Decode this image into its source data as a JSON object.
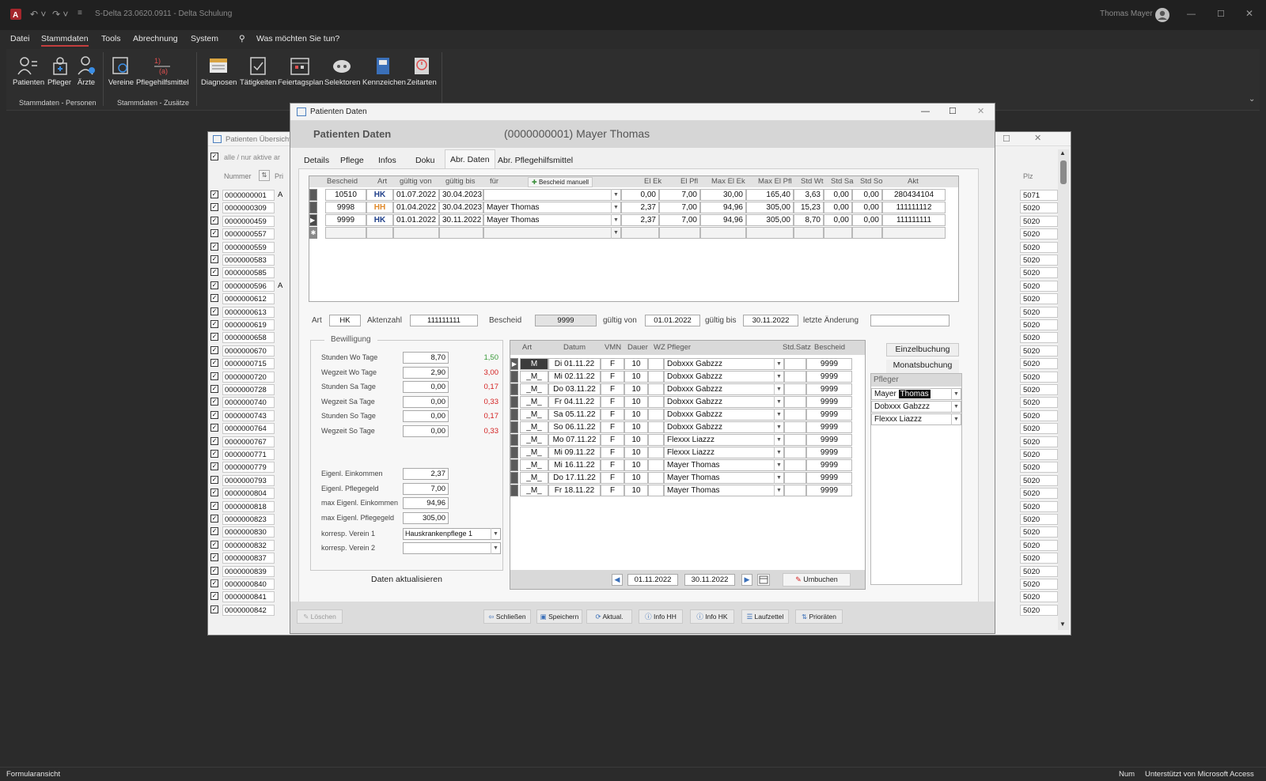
{
  "app": {
    "doc_title": "S-Delta 23.0620.0911 - Delta Schulung",
    "user": "Thomas Mayer"
  },
  "menu": [
    "Datei",
    "Stammdaten",
    "Tools",
    "Abrechnung",
    "System"
  ],
  "search": {
    "placeholder": "Was möchten Sie tun?"
  },
  "ribbon": {
    "buttons": [
      "Patienten",
      "Pfleger",
      "Ärzte",
      "Vereine",
      "Pflegehilfsmittel",
      "Diagnosen",
      "Tätigkeiten",
      "Feiertagsplan",
      "Selektoren",
      "Kennzeichen",
      "Zeitarten"
    ],
    "group_personen": "Stammdaten - Personen",
    "group_zusaetze": "Stammdaten - Zusätze"
  },
  "bg": {
    "title": "Patienten Übersicht",
    "filter": "alle / nur aktive ar",
    "col_nummer": "Nummer",
    "col_pri": "Pri",
    "col_plz": "Plz",
    "rows": [
      {
        "n": "0000000001",
        "a": "A",
        "p": "5071"
      },
      {
        "n": "0000000309",
        "a": "",
        "p": "5020"
      },
      {
        "n": "0000000459",
        "a": "",
        "p": "5020"
      },
      {
        "n": "0000000557",
        "a": "",
        "p": "5020"
      },
      {
        "n": "0000000559",
        "a": "",
        "p": "5020"
      },
      {
        "n": "0000000583",
        "a": "",
        "p": "5020"
      },
      {
        "n": "0000000585",
        "a": "",
        "p": "5020"
      },
      {
        "n": "0000000596",
        "a": "A",
        "p": "5020"
      },
      {
        "n": "0000000612",
        "a": "",
        "p": "5020"
      },
      {
        "n": "0000000613",
        "a": "",
        "p": "5020"
      },
      {
        "n": "0000000619",
        "a": "",
        "p": "5020"
      },
      {
        "n": "0000000658",
        "a": "",
        "p": "5020"
      },
      {
        "n": "0000000670",
        "a": "",
        "p": "5020"
      },
      {
        "n": "0000000715",
        "a": "",
        "p": "5020"
      },
      {
        "n": "0000000720",
        "a": "",
        "p": "5020"
      },
      {
        "n": "0000000728",
        "a": "",
        "p": "5020"
      },
      {
        "n": "0000000740",
        "a": "",
        "p": "5020"
      },
      {
        "n": "0000000743",
        "a": "",
        "p": "5020"
      },
      {
        "n": "0000000764",
        "a": "",
        "p": "5020"
      },
      {
        "n": "0000000767",
        "a": "",
        "p": "5020"
      },
      {
        "n": "0000000771",
        "a": "",
        "p": "5020"
      },
      {
        "n": "0000000779",
        "a": "",
        "p": "5020"
      },
      {
        "n": "0000000793",
        "a": "",
        "p": "5020"
      },
      {
        "n": "0000000804",
        "a": "",
        "p": "5020"
      },
      {
        "n": "0000000818",
        "a": "",
        "p": "5020"
      },
      {
        "n": "0000000823",
        "a": "",
        "p": "5020"
      },
      {
        "n": "0000000830",
        "a": "",
        "p": "5020"
      },
      {
        "n": "0000000832",
        "a": "",
        "p": "5020"
      },
      {
        "n": "0000000837",
        "a": "",
        "p": "5020"
      },
      {
        "n": "0000000839",
        "a": "",
        "p": "5020"
      },
      {
        "n": "0000000840",
        "a": "",
        "p": "5020"
      },
      {
        "n": "0000000841",
        "a": "",
        "p": "5020"
      },
      {
        "n": "0000000842",
        "a": "",
        "p": "5020"
      }
    ]
  },
  "dlg": {
    "title": "Patienten Daten",
    "header_left": "Patienten Daten",
    "header_right": "(0000000001) Mayer Thomas",
    "tabs": [
      "Details",
      "Pflege",
      "Infos",
      "Doku",
      "Abr. Daten",
      "Abr. Pflegehilfsmittel"
    ],
    "bescheid_cols": [
      "Bescheid",
      "Art",
      "gültig von",
      "gültig bis",
      "für",
      "El Ek",
      "El Pfl",
      "Max El Ek",
      "Max El Pfl",
      "Std Wt",
      "Std Sa",
      "Std So",
      "Akt"
    ],
    "bescheid_manuell": "Bescheid manuell",
    "bescheid_rows": [
      {
        "b": "10510",
        "art": "HK",
        "von": "01.07.2022",
        "bis": "30.04.2023",
        "fuer": "",
        "ek": "0,00",
        "pfl": "7,00",
        "mek": "30,00",
        "mpfl": "165,40",
        "wt": "3,63",
        "sa": "0,00",
        "so": "0,00",
        "akt": "280434104"
      },
      {
        "b": "9998",
        "art": "HH",
        "von": "01.04.2022",
        "bis": "30.04.2023",
        "fuer": "Mayer Thomas",
        "ek": "2,37",
        "pfl": "7,00",
        "mek": "94,96",
        "mpfl": "305,00",
        "wt": "15,23",
        "sa": "0,00",
        "so": "0,00",
        "akt": "111111112"
      },
      {
        "b": "9999",
        "art": "HK",
        "von": "01.01.2022",
        "bis": "30.11.2022",
        "fuer": "Mayer Thomas",
        "ek": "2,37",
        "pfl": "7,00",
        "mek": "94,96",
        "mpfl": "305,00",
        "wt": "8,70",
        "sa": "0,00",
        "so": "0,00",
        "akt": "111111111"
      }
    ],
    "art_label": "Art",
    "art_value": "HK",
    "akten_label": "Aktenzahl",
    "akten_value": "111111111",
    "bescheid_label": "Bescheid",
    "bescheid_value": "9999",
    "von_label": "gültig von",
    "von_value": "01.01.2022",
    "bis_label": "gültig bis",
    "bis_value": "30.11.2022",
    "aend_label": "letzte Änderung",
    "aend_value": "",
    "bew": {
      "title": "Bewilligung",
      "rows": [
        {
          "label": "Stunden Wo Tage",
          "value": "8,70",
          "extra": "1,50",
          "color": "#3a9a3a"
        },
        {
          "label": "Wegzeit Wo Tage",
          "value": "2,90",
          "extra": "3,00",
          "color": "#d42020"
        },
        {
          "label": "Stunden Sa Tage",
          "value": "0,00",
          "extra": "0,17",
          "color": "#d42020"
        },
        {
          "label": "Wegzeit Sa Tage",
          "value": "0,00",
          "extra": "0,33",
          "color": "#d42020"
        },
        {
          "label": "Stunden So Tage",
          "value": "0,00",
          "extra": "0,17",
          "color": "#d42020"
        },
        {
          "label": "Wegzeit So Tage",
          "value": "0,00",
          "extra": "0,33",
          "color": "#d42020"
        }
      ],
      "rows2": [
        {
          "label": "Eigenl. Einkommen",
          "value": "2,37"
        },
        {
          "label": "Eigenl. Pflegegeld",
          "value": "7,00"
        },
        {
          "label": "max Eigenl. Einkommen",
          "value": "94,96"
        },
        {
          "label": "max Eigenl. Pflegegeld",
          "value": "305,00"
        }
      ],
      "verein1_label": "korresp. Verein 1",
      "verein1_value": "Hauskrankenpflege 1",
      "verein2_label": "korresp. Verein 2",
      "verein2_value": "",
      "refresh": "Daten aktualisieren"
    },
    "book_cols": [
      "Art",
      "Datum",
      "VMN",
      "Dauer",
      "WZ",
      "Pfleger",
      "Std.Satz",
      "Bescheid"
    ],
    "book_rows": [
      {
        "art": "M",
        "datum": "Di 01.11.22",
        "vmn": "F",
        "dauer": "10",
        "pfleger": "Dobxxx Gabzzz",
        "bescheid": "9999"
      },
      {
        "art": "_M_",
        "datum": "Mi 02.11.22",
        "vmn": "F",
        "dauer": "10",
        "pfleger": "Dobxxx Gabzzz",
        "bescheid": "9999"
      },
      {
        "art": "_M_",
        "datum": "Do 03.11.22",
        "vmn": "F",
        "dauer": "10",
        "pfleger": "Dobxxx Gabzzz",
        "bescheid": "9999"
      },
      {
        "art": "_M_",
        "datum": "Fr 04.11.22",
        "vmn": "F",
        "dauer": "10",
        "pfleger": "Dobxxx Gabzzz",
        "bescheid": "9999"
      },
      {
        "art": "_M_",
        "datum": "Sa 05.11.22",
        "vmn": "F",
        "dauer": "10",
        "pfleger": "Dobxxx Gabzzz",
        "bescheid": "9999"
      },
      {
        "art": "_M_",
        "datum": "So 06.11.22",
        "vmn": "F",
        "dauer": "10",
        "pfleger": "Dobxxx Gabzzz",
        "bescheid": "9999"
      },
      {
        "art": "_M_",
        "datum": "Mo 07.11.22",
        "vmn": "F",
        "dauer": "10",
        "pfleger": "Flexxx Liazzz",
        "bescheid": "9999"
      },
      {
        "art": "_M_",
        "datum": "Mi 09.11.22",
        "vmn": "F",
        "dauer": "10",
        "pfleger": "Flexxx Liazzz",
        "bescheid": "9999"
      },
      {
        "art": "_M_",
        "datum": "Mi 16.11.22",
        "vmn": "F",
        "dauer": "10",
        "pfleger": "Mayer Thomas",
        "bescheid": "9999"
      },
      {
        "art": "_M_",
        "datum": "Do 17.11.22",
        "vmn": "F",
        "dauer": "10",
        "pfleger": "Mayer Thomas",
        "bescheid": "9999"
      },
      {
        "art": "_M_",
        "datum": "Fr 18.11.22",
        "vmn": "F",
        "dauer": "10",
        "pfleger": "Mayer Thomas",
        "bescheid": "9999"
      }
    ],
    "nav_from": "01.11.2022",
    "nav_to": "30.11.2022",
    "umbuchen": "Umbuchen",
    "einzel": "Einzelbuchung",
    "monat": "Monatsbuchung",
    "pfleger_title": "Pfleger",
    "pfleger_list": [
      "Mayer Thomas",
      "Dobxxx Gabzzz",
      "Flexxx Liazzz"
    ],
    "footer": [
      "Löschen",
      "Schließen",
      "Speichern",
      "Aktual.",
      "Info HH",
      "Info HK",
      "Laufzettel",
      "Prioräten"
    ]
  },
  "status": {
    "left": "Formularansicht",
    "num": "Num",
    "right": "Unterstützt von Microsoft Access"
  }
}
